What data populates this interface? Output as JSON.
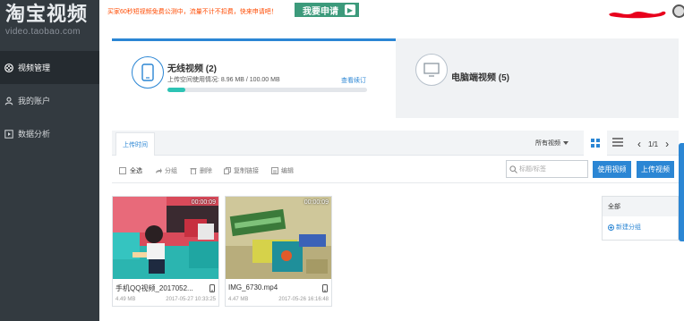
{
  "sidebar": {
    "logo_title": "淘宝视频",
    "logo_domain": "video.taobao.com",
    "items": [
      {
        "label": "视频管理",
        "icon": "film-reel-icon",
        "active": true
      },
      {
        "label": "我的账户",
        "icon": "user-icon",
        "active": false
      },
      {
        "label": "数据分析",
        "icon": "play-square-icon",
        "active": false
      }
    ]
  },
  "topbar": {
    "promo_text": "买家60秒短视频免费公测中，流量不计不扣费，快来申请吧！",
    "apply_label": "我要申请",
    "apply_arrow": "▶"
  },
  "wireless": {
    "title": "无线视频 (2)",
    "usage": "上传空间使用情况: 8.96 MB / 100.00 MB",
    "plan_link": "查看续订",
    "usage_fraction": 0.09
  },
  "pc": {
    "title": "电脑端视频 (5)"
  },
  "tabs": {
    "upload_time": "上传时间",
    "filter_label": "所有视频",
    "page_indicator": "1/1",
    "prev": "‹",
    "next": "›"
  },
  "actions": {
    "select_all": "全选",
    "group": "分组",
    "delete": "删除",
    "copy_link": "复制链接",
    "edit": "编辑",
    "search_placeholder": "标题/标签",
    "use_video": "使用视频",
    "upload_video": "上传视频"
  },
  "videos": [
    {
      "name": "手机QQ视频_2017052...",
      "duration": "00:00:09",
      "size": "4.49 MB",
      "date": "2017-05-27 10:33:25"
    },
    {
      "name": "IMG_6730.mp4",
      "duration": "00:00:09",
      "size": "4.47 MB",
      "date": "2017-05-26 16:16:48"
    }
  ],
  "groups": {
    "all": "全部",
    "new_group": "新建分组"
  },
  "colors": {
    "sidebar_bg": "#333a40",
    "accent_blue": "#2b86d4",
    "apply_green": "#3c9a7b",
    "progress_teal": "#2dc3b4",
    "promo_orange": "#ff4a00"
  }
}
